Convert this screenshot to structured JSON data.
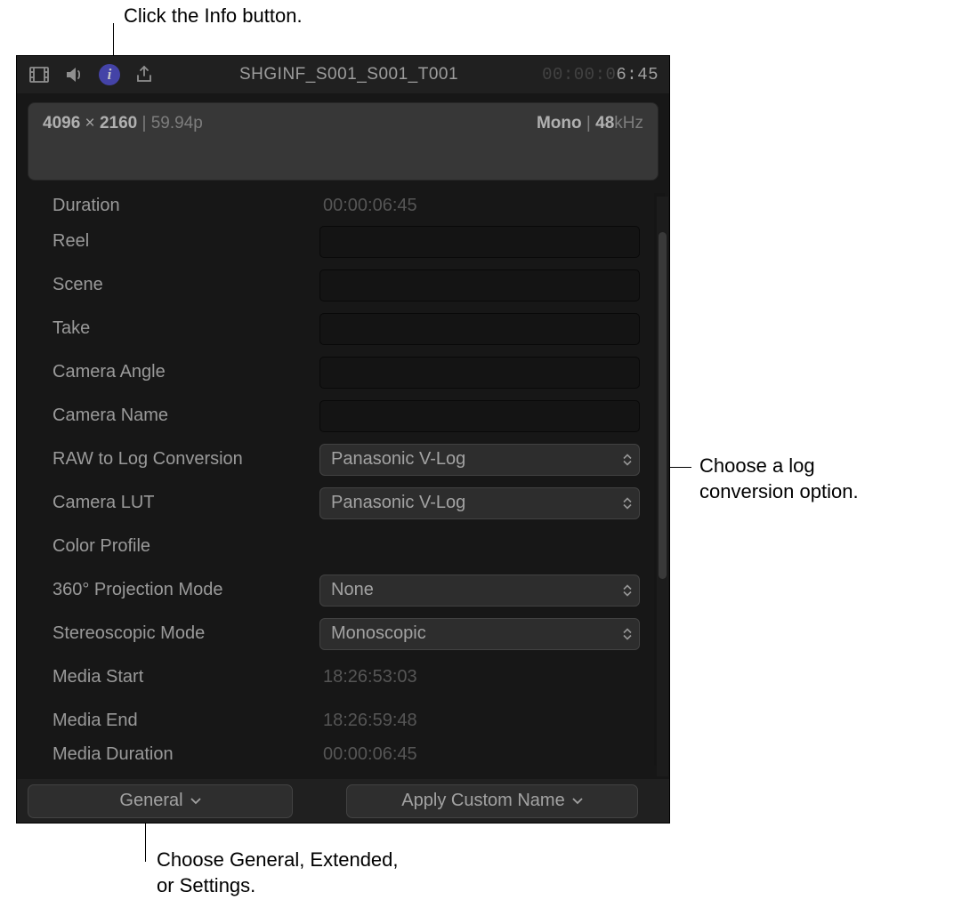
{
  "callouts": {
    "info": "Click the Info button.",
    "log": "Choose a log conversion option.",
    "general": "Choose General, Extended, or Settings."
  },
  "topbar": {
    "clip_title": "SHGINF_S001_S001_T001",
    "timecode_prefix": "00:00:0",
    "timecode_end": "6:45"
  },
  "format": {
    "resolution_w": "4096",
    "resolution_h": "2160",
    "fps": "59.94p",
    "audio_mode": "Mono",
    "audio_rate": "48",
    "audio_unit": "kHz"
  },
  "rows": {
    "duration_label": "Duration",
    "duration_value": "00:00:06:45",
    "reel_label": "Reel",
    "scene_label": "Scene",
    "take_label": "Take",
    "camera_angle_label": "Camera Angle",
    "camera_name_label": "Camera Name",
    "raw_log_label": "RAW to Log Conversion",
    "raw_log_value": "Panasonic V-Log",
    "camera_lut_label": "Camera LUT",
    "camera_lut_value": "Panasonic V-Log",
    "color_profile_label": "Color Profile",
    "proj_label": "360° Projection Mode",
    "proj_value": "None",
    "stereo_label": "Stereoscopic Mode",
    "stereo_value": "Monoscopic",
    "media_start_label": "Media Start",
    "media_start_value": "18:26:53:03",
    "media_end_label": "Media End",
    "media_end_value": "18:26:59:48",
    "media_dur_label": "Media Duration",
    "media_dur_value": "00:00:06:45"
  },
  "bottom": {
    "general": "General",
    "apply": "Apply Custom Name"
  }
}
